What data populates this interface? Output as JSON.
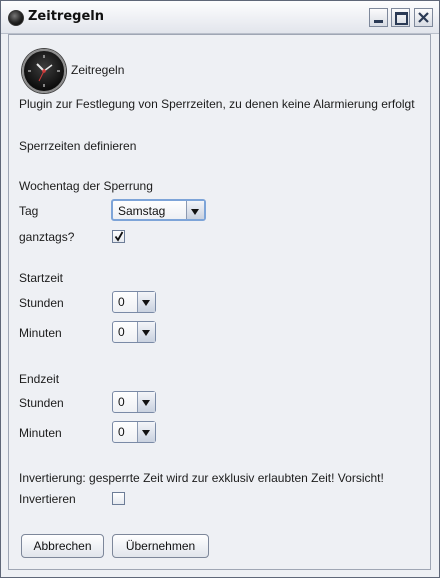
{
  "window": {
    "title": "Zeitregeln"
  },
  "plugin": {
    "name": "Zeitregeln",
    "description": "Plugin zur Festlegung von Sperrzeiten, zu denen keine Alarmierung erfolgt"
  },
  "section_define": "Sperrzeiten definieren",
  "weekday": {
    "heading": "Wochentag der Sperrung",
    "day_label": "Tag",
    "day_value": "Samstag",
    "fullday_label": "ganztags?",
    "fullday_checked": true
  },
  "start": {
    "heading": "Startzeit",
    "hours_label": "Stunden",
    "hours_value": "0",
    "minutes_label": "Minuten",
    "minutes_value": "0"
  },
  "end": {
    "heading": "Endzeit",
    "hours_label": "Stunden",
    "hours_value": "0",
    "minutes_label": "Minuten",
    "minutes_value": "0"
  },
  "invert": {
    "info": "Invertierung: gesperrte Zeit wird zur exklusiv erlaubten Zeit! Vorsicht!",
    "label": "Invertieren",
    "checked": false
  },
  "buttons": {
    "cancel": "Abbrechen",
    "apply": "Übernehmen"
  }
}
